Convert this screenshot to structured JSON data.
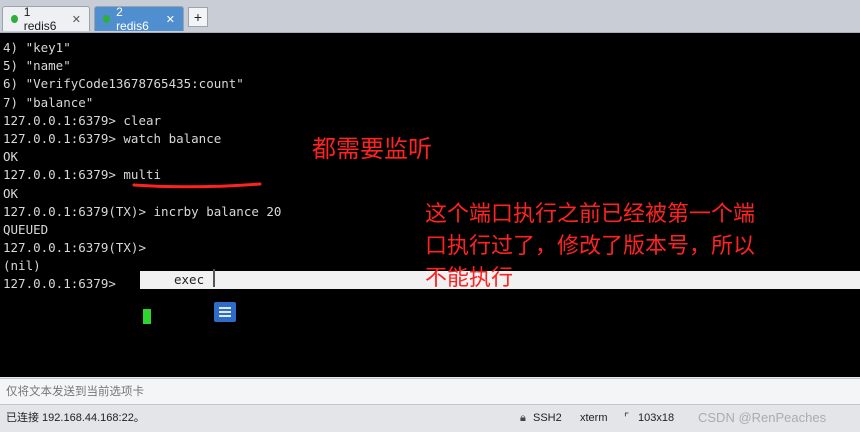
{
  "tabs": [
    {
      "label": "1 redis6",
      "close": "✕"
    },
    {
      "label": "2 redis6",
      "close": "✕"
    }
  ],
  "add_tab_label": "+",
  "terminal": {
    "lines": [
      "4) \"key1\"",
      "5) \"name\"",
      "6) \"VerifyCode13678765435:count\"",
      "7) \"balance\"",
      "127.0.0.1:6379> clear",
      "127.0.0.1:6379> watch balance",
      "OK",
      "127.0.0.1:6379> multi",
      "OK",
      "127.0.0.1:6379(TX)> incrby balance 20",
      "QUEUED",
      "127.0.0.1:6379(TX)> ",
      "(nil)",
      "127.0.0.1:6379> "
    ],
    "highlighted_command": "exec",
    "annotation_1": "都需要监听",
    "annotation_2": "这个端口执行之前已经被第一个端口执行过了，修改了版本号，所以不能执行"
  },
  "send_bar_placeholder": "仅将文本发送到当前选项卡",
  "status": {
    "connection": "已连接 192.168.44.168:22。",
    "protocol": "SSH2",
    "terminal_type": "xterm",
    "size": "103x18",
    "watermark": "CSDN @RenPeaches"
  },
  "colors": {
    "active_tab": "#4f8fcf",
    "annotation": "#ff2222",
    "cursor": "#2fd52f"
  }
}
